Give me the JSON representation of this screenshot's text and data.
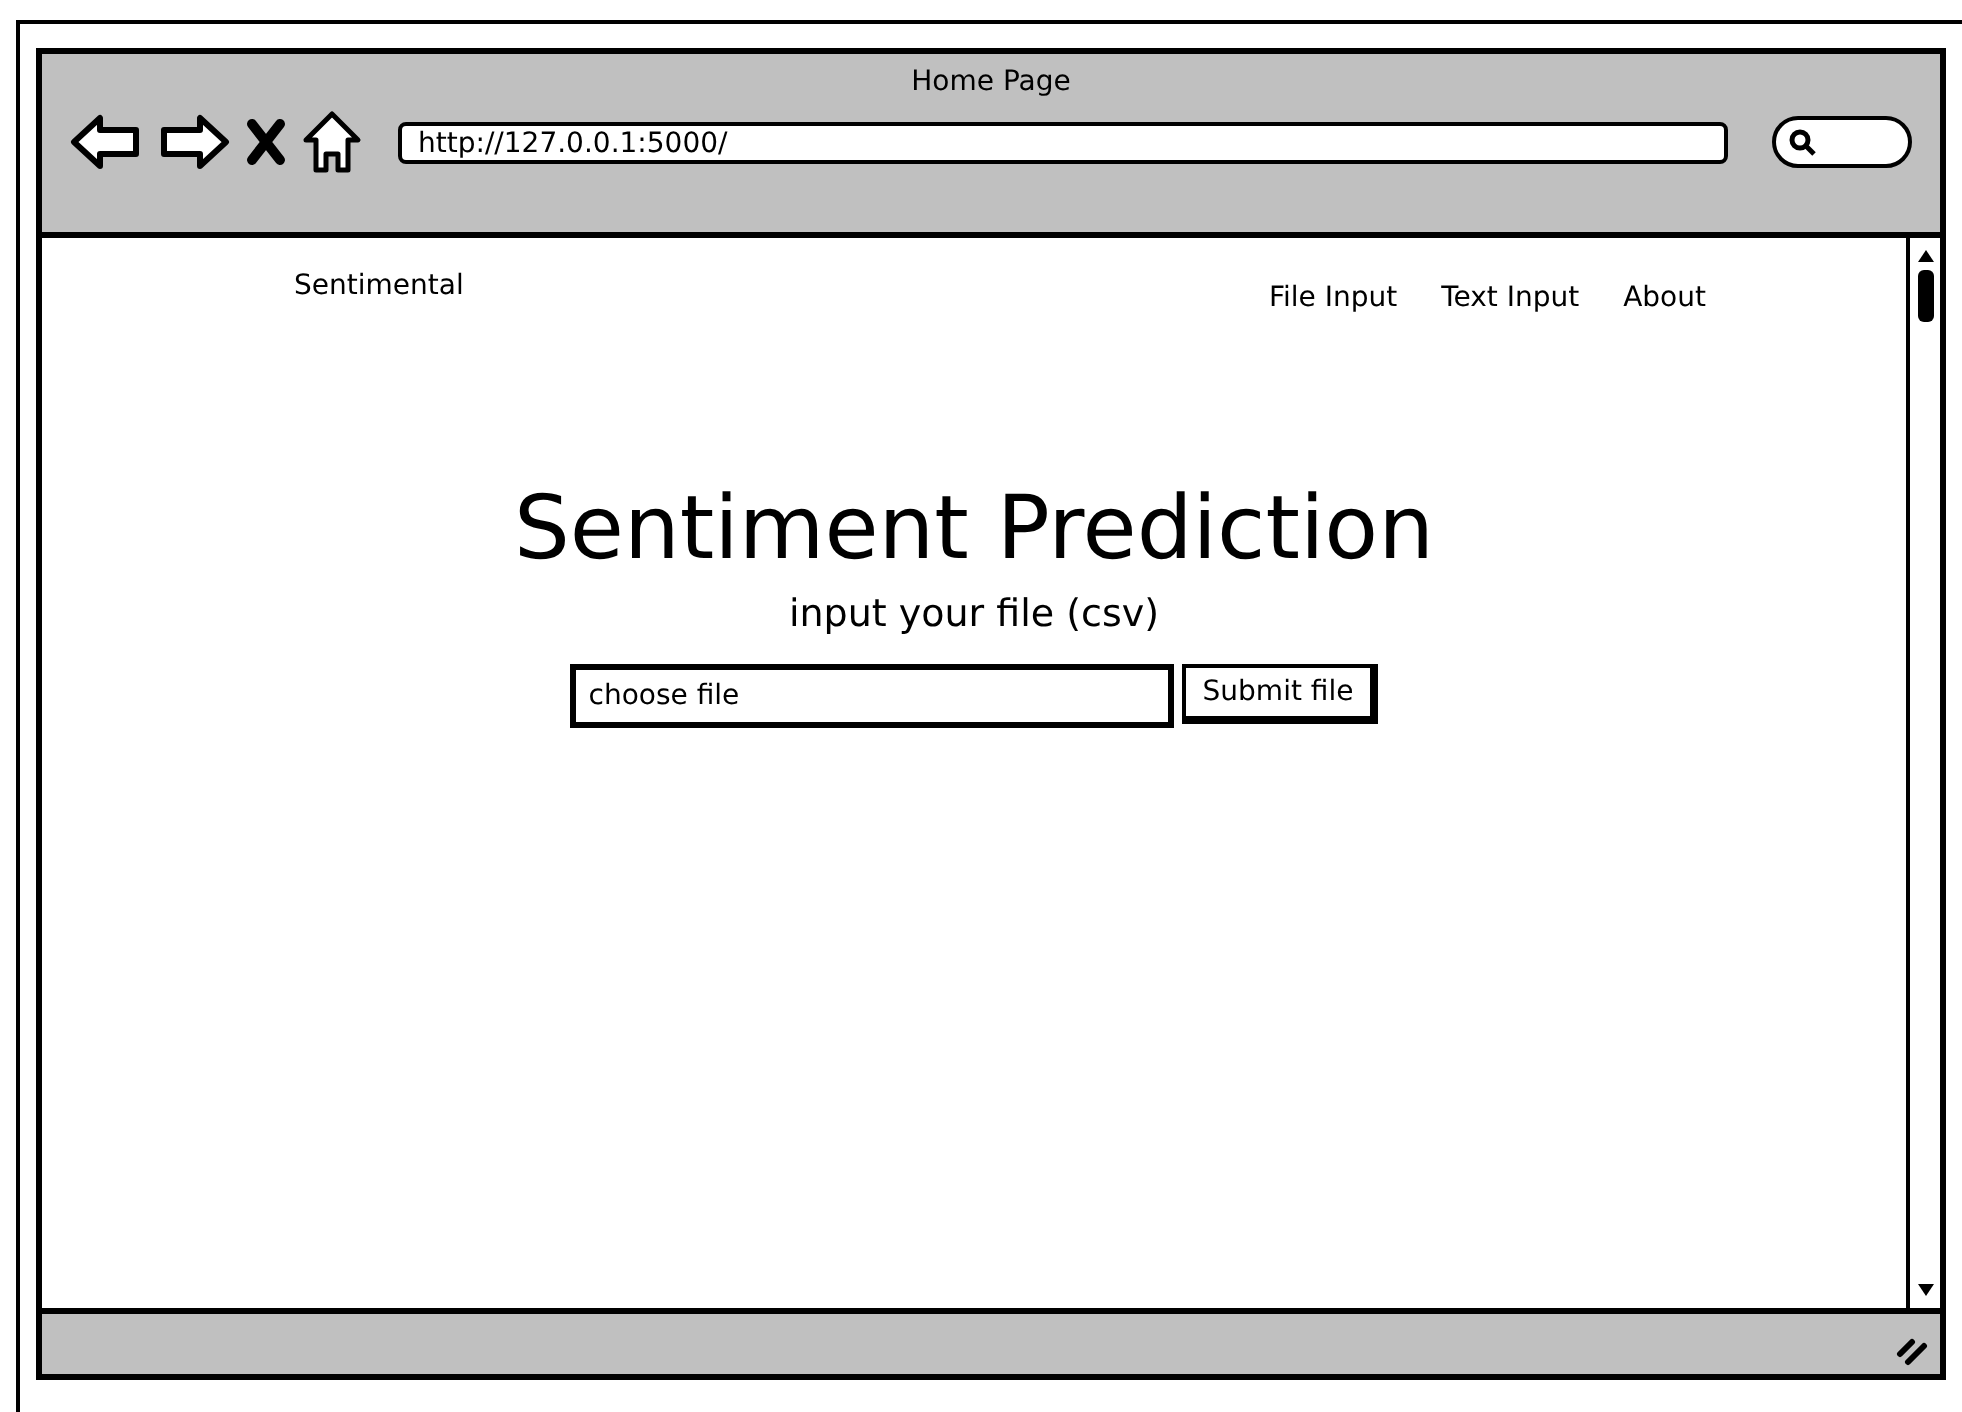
{
  "window": {
    "title": "Home Page",
    "address": "http://127.0.0.1:5000/"
  },
  "site": {
    "brand": "Sentimental",
    "nav": [
      "File Input",
      "Text Input",
      "About"
    ]
  },
  "main": {
    "heading": "Sentiment Prediction",
    "subheading": "input your file (csv)",
    "file_field": {
      "placeholder": "choose file"
    },
    "submit_button": "Submit file"
  }
}
